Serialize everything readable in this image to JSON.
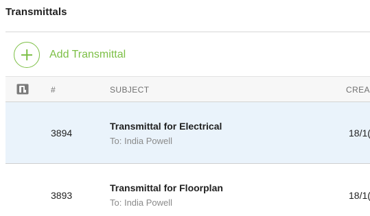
{
  "header": {
    "title": "Transmittals"
  },
  "actions": {
    "add_label": "Add Transmittal"
  },
  "table": {
    "columns": {
      "attachment_icon": "attachment-icon",
      "number": "#",
      "subject": "SUBJECT",
      "created": "CREA"
    },
    "rows": [
      {
        "number": "3894",
        "subject": "Transmittal for Electrical",
        "to": "To: India Powell",
        "created": "18/1(",
        "selected": true
      },
      {
        "number": "3893",
        "subject": "Transmittal for Floorplan",
        "to": "To: India Powell",
        "created": "18/1(",
        "selected": false
      }
    ]
  },
  "colors": {
    "accent": "#7cbf45",
    "selected_row": "#eaf3fb",
    "header_bg": "#f7f7f7"
  }
}
